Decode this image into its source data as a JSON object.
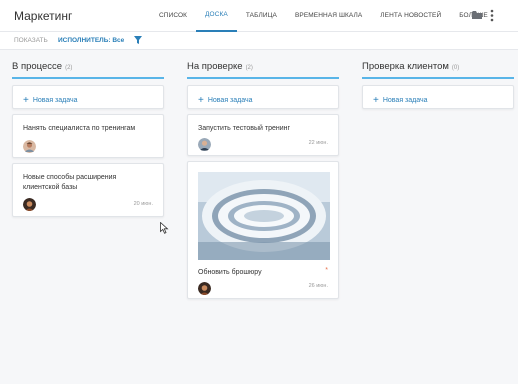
{
  "app": {
    "title": "Маркетинг"
  },
  "nav": {
    "tabs": [
      {
        "label": "СПИСОК",
        "active": false
      },
      {
        "label": "ДОСКА",
        "active": true
      },
      {
        "label": "ТАБЛИЦА",
        "active": false
      },
      {
        "label": "ВРЕМЕННАЯ ШКАЛА",
        "active": false
      },
      {
        "label": "ЛЕНТА НОВОСТЕЙ",
        "active": false
      },
      {
        "label": "БОЛЬШЕ",
        "active": false
      }
    ],
    "icons": [
      "folder-icon",
      "more-vertical-icon"
    ]
  },
  "filter": {
    "show_label": "ПОКАЗАТЬ",
    "assignee_label": "ИСПОЛНИТЕЛЬ: Все",
    "icon": "filter-icon"
  },
  "columns": [
    {
      "title": "В процессе",
      "count": "(2)",
      "add_label": "Новая задача",
      "cards": [
        {
          "title": "Нанять специалиста по тренингам",
          "date": ""
        },
        {
          "title": "Новые способы расширения клиентской базы",
          "date": "20 июн."
        }
      ]
    },
    {
      "title": "На проверке",
      "count": "(2)",
      "add_label": "Новая задача",
      "cards": [
        {
          "title": "Запустить тестовый тренинг",
          "date": "22 июн."
        },
        {
          "title": "Обновить брошюру",
          "date": "26 июн.",
          "priority": "*"
        }
      ]
    },
    {
      "title": "Проверка клиентом",
      "count": "(0)",
      "add_label": "Новая задача",
      "cards": []
    }
  ],
  "colors": {
    "accent": "#2a7fb8",
    "column_underline": "#59b5e8",
    "priority": "#e8704a"
  }
}
